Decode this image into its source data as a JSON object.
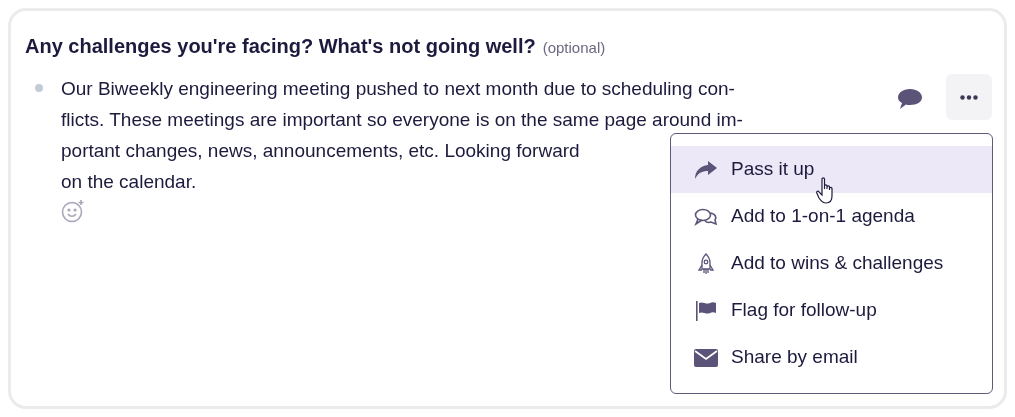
{
  "question": {
    "title": "Any challenges you're facing? What's not going well?",
    "note": "(optional)"
  },
  "answer": {
    "lines": [
      "Our Biweekly engineering meeting pushed to next month due to scheduling con-",
      "flicts. These meetings are important so everyone is on the same page around im-",
      "portant changes, news, announcements, etc. Looking forward",
      "on the calendar."
    ]
  },
  "menu": {
    "items": [
      {
        "kind": "share",
        "label": "Pass it up",
        "highlighted": true
      },
      {
        "kind": "chat",
        "label": "Add to 1-on-1 agenda",
        "highlighted": false
      },
      {
        "kind": "rocket",
        "label": "Add to wins & challenges",
        "highlighted": false
      },
      {
        "kind": "flag",
        "label": "Flag for follow-up",
        "highlighted": false
      },
      {
        "kind": "mail",
        "label": "Share by email",
        "highlighted": false
      }
    ]
  }
}
